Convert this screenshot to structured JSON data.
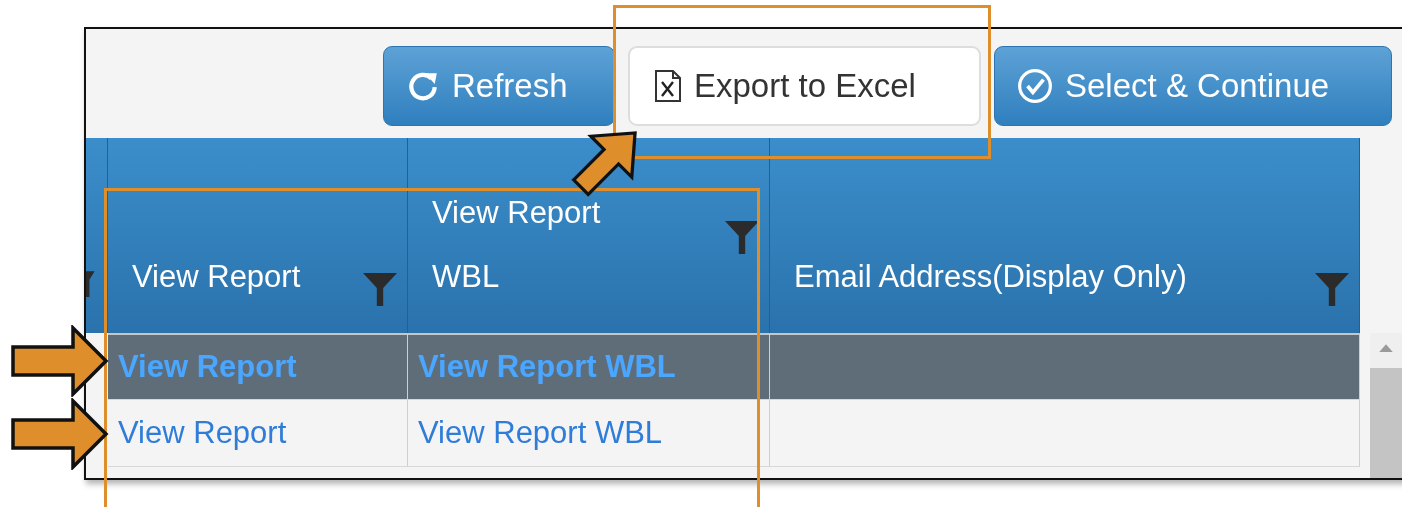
{
  "toolbar": {
    "buttons": [
      {
        "kind": "refresh",
        "label": "Refresh"
      },
      {
        "kind": "export",
        "label": "Export to Excel"
      },
      {
        "kind": "confirm",
        "label": "Select & Continue"
      }
    ]
  },
  "table": {
    "columns": [
      {
        "label": "View Report"
      },
      {
        "label": "View Report\nWBL"
      },
      {
        "label": "Email Address(Display Only)"
      }
    ],
    "rows": [
      {
        "selected": true,
        "cells": [
          "View Report",
          "View Report WBL"
        ]
      },
      {
        "selected": false,
        "cells": [
          "View Report",
          "View Report WBL"
        ]
      }
    ]
  }
}
